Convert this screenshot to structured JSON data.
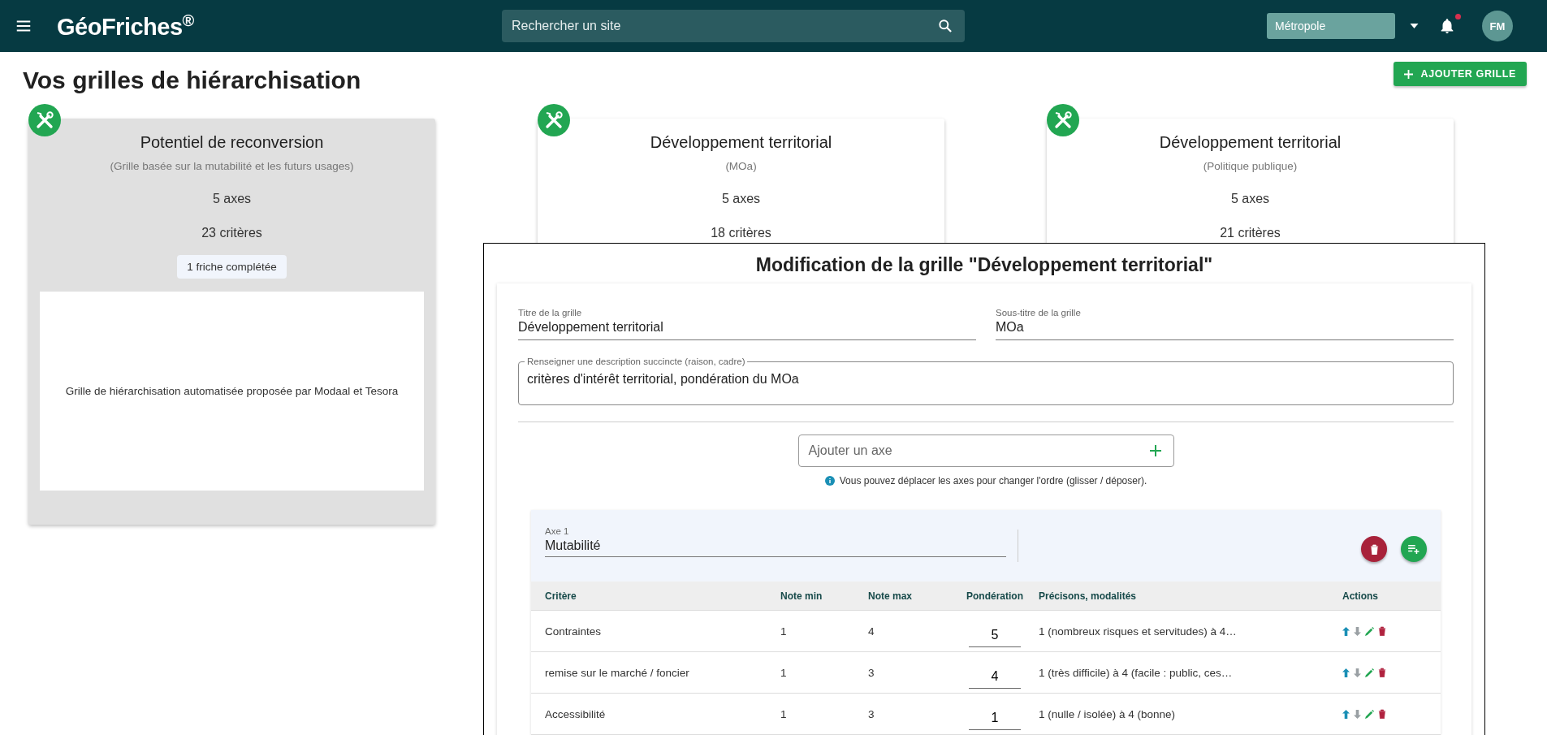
{
  "header": {
    "logo": "GéoFriches$^{®}$",
    "search": {
      "placeholder": "Rechercher un site"
    },
    "territory": {
      "value": "Métropole"
    },
    "notifications": {
      "unread": true
    },
    "avatar": "FM"
  },
  "page": {
    "title": "Vos grilles de hiérarchisation",
    "add_button": "AJOUTER GRILLE"
  },
  "cards": [
    {
      "title": "Potentiel de reconversion",
      "subtitle": "(Grille basée sur la mutabilité et les futurs usages)",
      "axes": "5 axes",
      "criteria": "23 critères",
      "badge": "1 friche complétée",
      "description": "Grille de hiérarchisation automatisée proposée par Modaal et Tesora",
      "selected": true
    },
    {
      "title": "Développement territorial",
      "subtitle": "(MOa)",
      "axes": "5 axes",
      "criteria": "18 critères",
      "selected": false
    },
    {
      "title": "Développement territorial",
      "subtitle": "(Politique publique)",
      "axes": "5 axes",
      "criteria": "21 critères",
      "selected": false
    }
  ],
  "modal": {
    "title": "Modification de la grille \"Développement territorial\"",
    "grid_title": {
      "label": "Titre de la grille",
      "value": "Développement territorial"
    },
    "grid_subtitle": {
      "label": "Sous-titre de la grille",
      "value": "MOa"
    },
    "description": {
      "label": "Renseigner une description succincte (raison, cadre)",
      "value": "critères d'intérêt territorial, pondération du MOa"
    },
    "add_axis": {
      "placeholder": "Ajouter un axe"
    },
    "info": "Vous pouvez déplacer les axes pour changer l'ordre (glisser / déposer).",
    "axes": [
      {
        "label": "Axe 1",
        "value": "Mutabilité",
        "columns": [
          "Critère",
          "Note min",
          "Note max",
          "Pondération",
          "Précisons, modalités",
          "Actions"
        ],
        "rows": [
          {
            "criterion": "Contraintes",
            "note_min": "1",
            "note_max": "4",
            "weight": "5",
            "details": "1 (nombreux risques et servitudes) à 4…"
          },
          {
            "criterion": "remise sur le marché / foncier",
            "note_min": "1",
            "note_max": "3",
            "weight": "4",
            "details": "1 (très difficile) à 4 (facile : public, ces…"
          },
          {
            "criterion": "Accessibilité",
            "note_min": "1",
            "note_max": "3",
            "weight": "1",
            "details": "1 (nulle / isolée) à 4 (bonne)"
          }
        ]
      }
    ]
  }
}
